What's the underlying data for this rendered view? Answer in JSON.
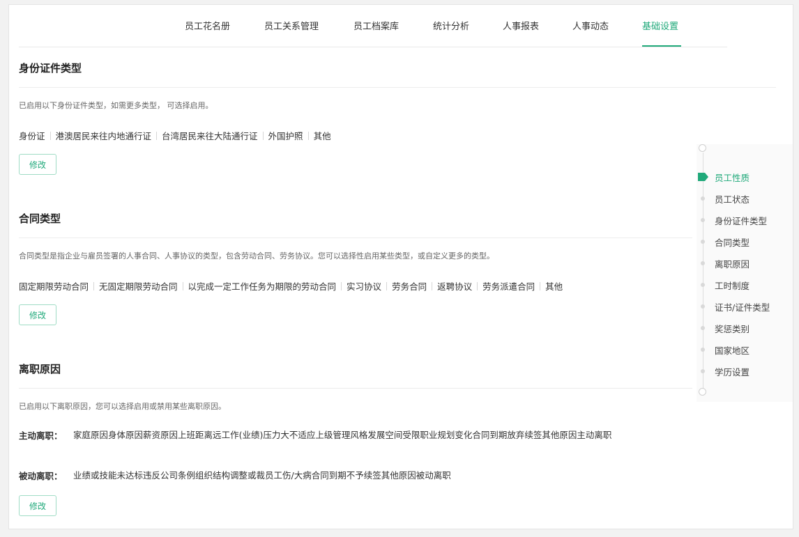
{
  "nav": {
    "tabs": [
      "员工花名册",
      "员工关系管理",
      "员工档案库",
      "统计分析",
      "人事报表",
      "人事动态",
      "基础设置"
    ],
    "active_index": 6
  },
  "sections": {
    "id_types": {
      "title": "身份证件类型",
      "desc": "已启用以下身份证件类型，如需更多类型， 可选择启用。",
      "items": [
        "身份证",
        "港澳居民来往内地通行证",
        "台湾居民来往大陆通行证",
        "外国护照",
        "其他"
      ],
      "button": "修改"
    },
    "contract_types": {
      "title": "合同类型",
      "desc": "合同类型是指企业与雇员签署的人事合同、人事协议的类型，包含劳动合同、劳务协议。您可以选择性启用某些类型，或自定义更多的类型。",
      "items": [
        "固定期限劳动合同",
        "无固定期限劳动合同",
        "以完成一定工作任务为期限的劳动合同",
        "实习协议",
        "劳务合同",
        "返聘协议",
        "劳务派遣合同",
        "其他"
      ],
      "button": "修改"
    },
    "leave_reasons": {
      "title": "离职原因",
      "desc": "已启用以下离职原因，您可以选择启用或禁用某些离职原因。",
      "active_label": "主动离职：",
      "active_items": [
        "家庭原因",
        "身体原因",
        "薪资原因",
        "上班距离远",
        "工作(业绩)压力大",
        "不适应上级管理风格",
        "发展空间受限",
        "职业规划变化",
        "合同到期放弃续签",
        "其他原因主动离职"
      ],
      "passive_label": "被动离职：",
      "passive_items": [
        "业绩或技能未达标",
        "违反公司条例",
        "组织结构调整或裁员",
        "工伤/大病",
        "合同到期不予续签",
        "其他原因被动离职"
      ],
      "button": "修改"
    }
  },
  "anchor_nav": {
    "items": [
      "员工性质",
      "员工状态",
      "身份证件类型",
      "合同类型",
      "离职原因",
      "工时制度",
      "证书/证件类型",
      "奖惩类别",
      "国家地区",
      "学历设置"
    ],
    "active_index": 0,
    "accent": "#20a97a"
  },
  "colors": {
    "accent": "#20a97a",
    "border": "#9fdcc5"
  }
}
